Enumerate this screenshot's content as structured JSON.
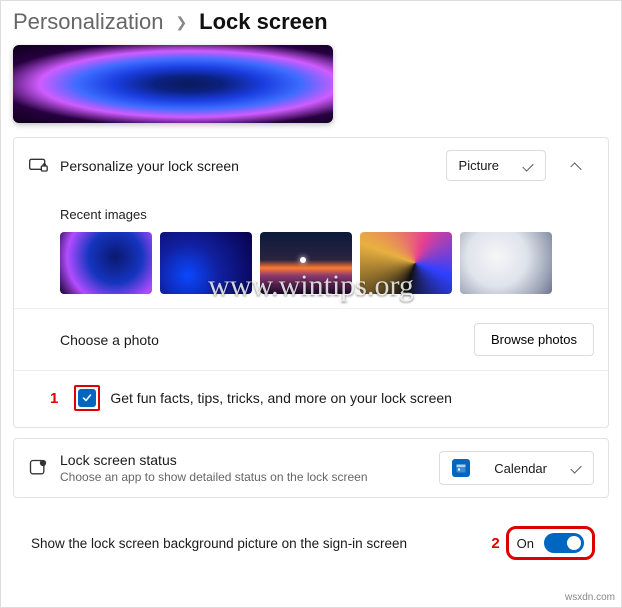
{
  "breadcrumb": {
    "parent": "Personalization",
    "current": "Lock screen"
  },
  "personalize": {
    "label": "Personalize your lock screen",
    "dropdown_value": "Picture",
    "recent_label": "Recent images",
    "choose_label": "Choose a photo",
    "browse_label": "Browse photos",
    "funfacts_label": "Get fun facts, tips, tricks, and more on your lock screen"
  },
  "status": {
    "title": "Lock screen status",
    "subtitle": "Choose an app to show detailed status on the lock screen",
    "app_value": "Calendar"
  },
  "signin": {
    "label": "Show the lock screen background picture on the sign-in screen",
    "toggle_text": "On",
    "toggle_state": true
  },
  "annotations": {
    "one": "1",
    "two": "2"
  },
  "watermark": "www.wintips.org",
  "credit": "wsxdn.com"
}
